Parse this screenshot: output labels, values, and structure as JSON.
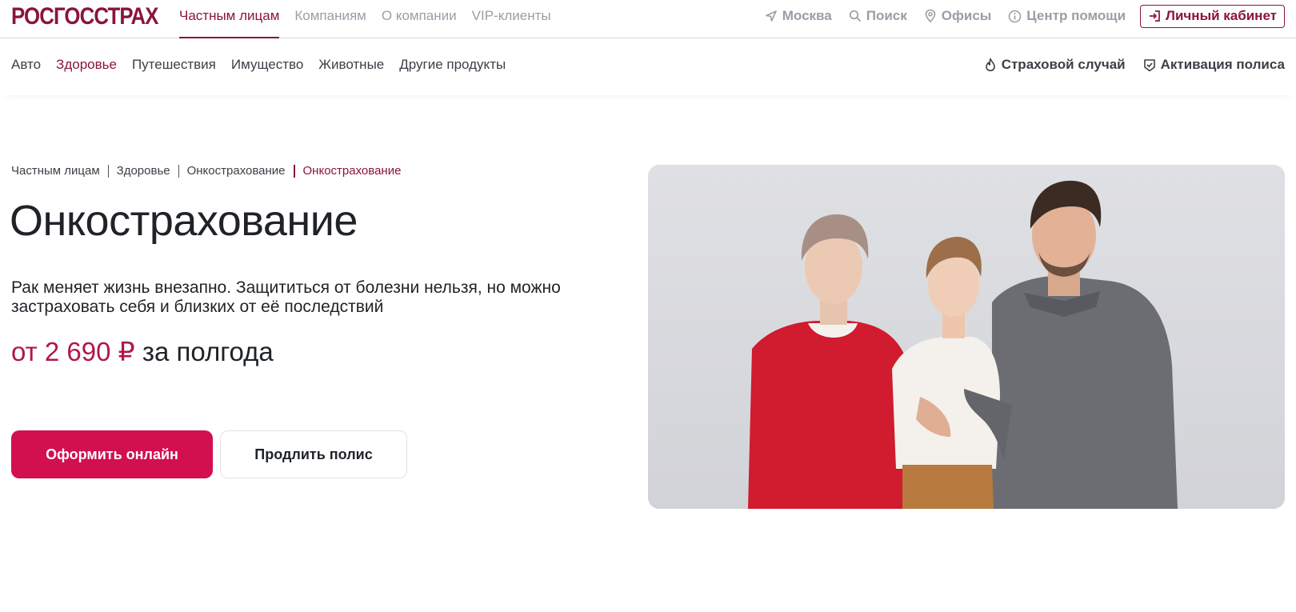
{
  "header": {
    "logo": "РОСГОССТРАХ",
    "nav": [
      {
        "label": "Частным лицам",
        "active": true
      },
      {
        "label": "Компаниям",
        "active": false
      },
      {
        "label": "О компании",
        "active": false
      },
      {
        "label": "VIP-клиенты",
        "active": false
      }
    ],
    "city": "Москва",
    "search": "Поиск",
    "offices": "Офисы",
    "help": "Центр помощи",
    "cabinet": "Личный кабинет"
  },
  "subnav": {
    "items": [
      {
        "label": "Авто",
        "active": false
      },
      {
        "label": "Здоровье",
        "active": true
      },
      {
        "label": "Путешествия",
        "active": false
      },
      {
        "label": "Имущество",
        "active": false
      },
      {
        "label": "Животные",
        "active": false
      },
      {
        "label": "Другие продукты",
        "active": false
      }
    ],
    "insured_event": "Страховой случай",
    "activation": "Активация полиса"
  },
  "breadcrumb": [
    "Частным лицам",
    "Здоровье",
    "Онкострахование",
    "Онкострахование"
  ],
  "main": {
    "title": "Онкострахование",
    "description": "Рак меняет жизнь внезапно. Защититься от болезни нельзя, но можно застраховать себя и близких от её последствий",
    "price_amount": "от 2 690 ₽",
    "price_period": "за полгода",
    "buy_button": "Оформить онлайн",
    "renew_button": "Продлить полис"
  },
  "colors": {
    "brand": "#8a1538",
    "primary_button": "#d20f4f",
    "price": "#b0174a"
  },
  "icons": [
    "location-arrow-icon",
    "search-icon",
    "map-pin-icon",
    "info-icon",
    "login-icon",
    "flame-icon",
    "check-shield-icon"
  ]
}
